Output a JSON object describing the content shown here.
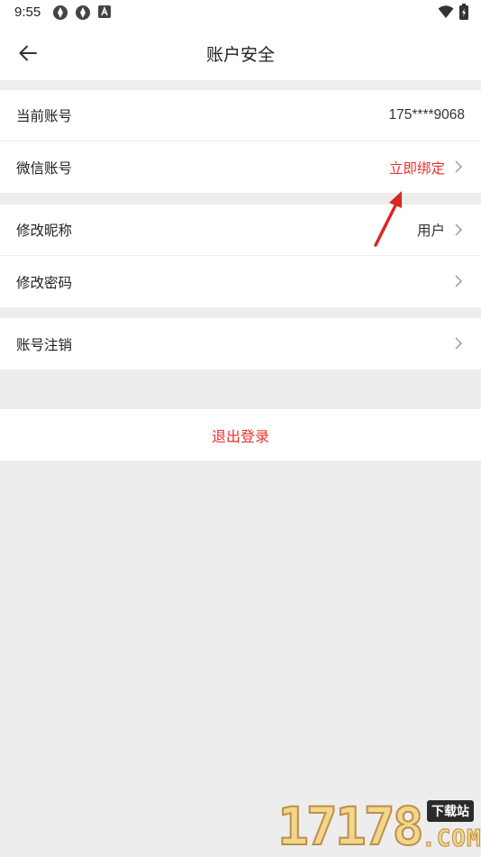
{
  "status_bar": {
    "time": "9:55"
  },
  "nav": {
    "title": "账户安全",
    "back_icon": "arrow-left-icon"
  },
  "section_account": {
    "current_account_label": "当前账号",
    "current_account_value": "175****9068",
    "wechat_label": "微信账号",
    "wechat_value": "立即绑定"
  },
  "section_profile": {
    "nickname_label": "修改昵称",
    "nickname_value": "用户",
    "password_label": "修改密码"
  },
  "section_cancel": {
    "cancel_label": "账号注销"
  },
  "logout": {
    "label": "退出登录"
  },
  "watermark": {
    "digits": "17178",
    "badge": "下载站",
    "domain": ".COM"
  },
  "colors": {
    "accent_red": "#e5322d",
    "background": "#ededed",
    "card": "#ffffff"
  }
}
